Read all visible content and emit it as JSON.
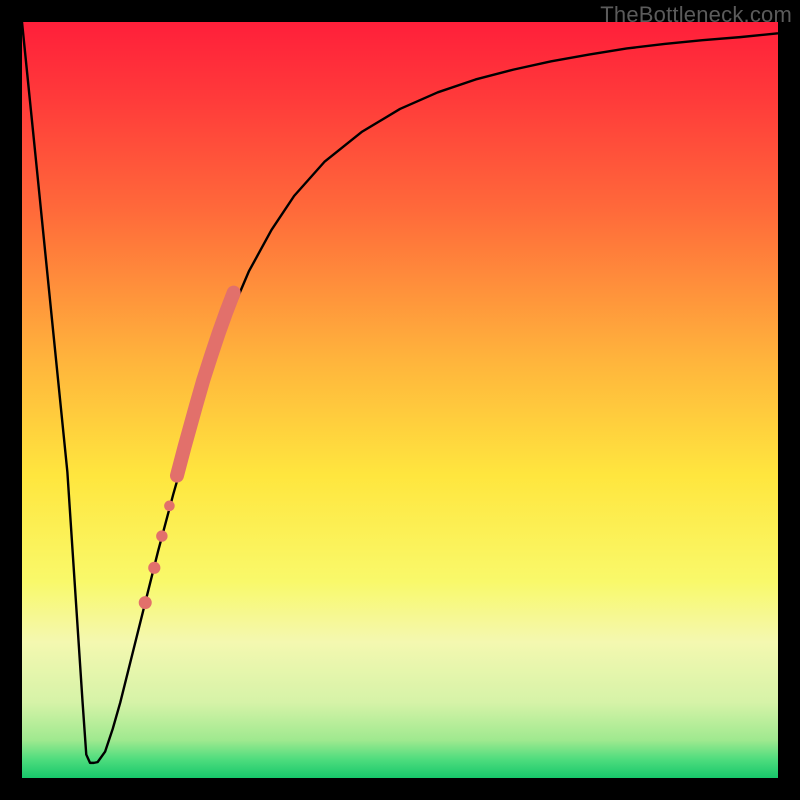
{
  "watermark": "TheBottleneck.com",
  "chart_data": {
    "type": "line",
    "title": "",
    "xlabel": "",
    "ylabel": "",
    "xlim": [
      0,
      100
    ],
    "ylim": [
      0,
      100
    ],
    "grid": false,
    "legend": false,
    "background_gradient": {
      "stops": [
        {
          "pos": 0.0,
          "color": "#ff1f3a"
        },
        {
          "pos": 0.1,
          "color": "#ff3a3a"
        },
        {
          "pos": 0.25,
          "color": "#ff6a3a"
        },
        {
          "pos": 0.45,
          "color": "#ffb53c"
        },
        {
          "pos": 0.6,
          "color": "#ffe63e"
        },
        {
          "pos": 0.74,
          "color": "#f9f96a"
        },
        {
          "pos": 0.82,
          "color": "#f4f8b0"
        },
        {
          "pos": 0.9,
          "color": "#d6f3a8"
        },
        {
          "pos": 0.95,
          "color": "#9fe98f"
        },
        {
          "pos": 0.975,
          "color": "#4fdd7e"
        },
        {
          "pos": 1.0,
          "color": "#17c76b"
        }
      ]
    },
    "series": [
      {
        "name": "bottleneck-curve",
        "color": "#000000",
        "stroke_width": 2.4,
        "x": [
          0.0,
          2.0,
          4.0,
          6.0,
          8.0,
          8.5,
          9.0,
          9.5,
          10.0,
          11.0,
          12.0,
          13.0,
          14.0,
          16.0,
          18.0,
          20.0,
          22.0,
          24.0,
          26.0,
          28.0,
          30.0,
          33.0,
          36.0,
          40.0,
          45.0,
          50.0,
          55.0,
          60.0,
          65.0,
          70.0,
          75.0,
          80.0,
          85.0,
          90.0,
          95.0,
          100.0
        ],
        "values": [
          100.0,
          80.2,
          60.3,
          40.5,
          10.2,
          3.1,
          2.0,
          2.0,
          2.1,
          3.5,
          6.5,
          10.0,
          14.0,
          22.0,
          30.0,
          37.5,
          44.5,
          51.0,
          57.0,
          62.3,
          67.0,
          72.5,
          77.0,
          81.5,
          85.5,
          88.5,
          90.7,
          92.4,
          93.7,
          94.8,
          95.7,
          96.5,
          97.1,
          97.6,
          98.0,
          98.5
        ]
      }
    ],
    "annotations": {
      "highlight_segment": {
        "color": "#e2706b",
        "points_x": [
          16.3,
          17.5,
          18.5,
          19.5,
          20.5,
          21.5,
          22.5,
          23.0,
          24.0,
          25.0,
          26.0,
          27.0,
          28.0
        ],
        "points_values": [
          23.2,
          27.8,
          32.0,
          36.0,
          40.0,
          43.8,
          47.4,
          49.2,
          52.7,
          55.8,
          58.8,
          61.6,
          64.2
        ],
        "thick_from_index": 4,
        "thin_dot_indices": [
          0,
          1,
          2,
          3
        ]
      }
    }
  }
}
